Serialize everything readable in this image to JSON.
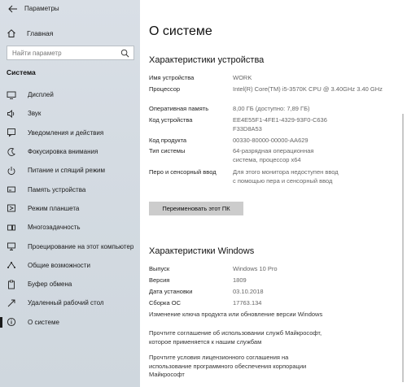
{
  "window": {
    "title": "Параметры"
  },
  "sidebar": {
    "home_label": "Главная",
    "search_placeholder": "Найти параметр",
    "section": "Система",
    "items": [
      {
        "label": "Дисплей",
        "icon": "display-icon"
      },
      {
        "label": "Звук",
        "icon": "sound-icon"
      },
      {
        "label": "Уведомления и действия",
        "icon": "notifications-icon"
      },
      {
        "label": "Фокусировка внимания",
        "icon": "focus-assist-icon"
      },
      {
        "label": "Питание и спящий режим",
        "icon": "power-icon"
      },
      {
        "label": "Память устройства",
        "icon": "storage-icon"
      },
      {
        "label": "Режим планшета",
        "icon": "tablet-mode-icon"
      },
      {
        "label": "Многозадачность",
        "icon": "multitasking-icon"
      },
      {
        "label": "Проецирование на этот компьютер",
        "icon": "projecting-icon"
      },
      {
        "label": "Общие возможности",
        "icon": "shared-experiences-icon"
      },
      {
        "label": "Буфер обмена",
        "icon": "clipboard-icon"
      },
      {
        "label": "Удаленный рабочий стол",
        "icon": "remote-desktop-icon"
      },
      {
        "label": "О системе",
        "icon": "info-icon",
        "selected": true
      }
    ]
  },
  "main": {
    "title": "О системе",
    "device_specs": {
      "heading": "Характеристики устройства",
      "rows": [
        {
          "key": "Имя устройства",
          "value": "WORK"
        },
        {
          "key": "Процессор",
          "value": "Intel(R) Core(TM) i5-3570K CPU @ 3.40GHz   3.40 GHz"
        },
        {
          "key": "Оперативная память",
          "value": "8,00 ГБ (доступно: 7,89 ГБ)"
        },
        {
          "key": "Код устройства",
          "value": "EE4E55F1-4FE1-4329-93F0-C636F33D8A53"
        },
        {
          "key": "Код продукта",
          "value": "00330-80000-00000-AA629"
        },
        {
          "key": "Тип системы",
          "value": "64-разрядная операционная система, процессор x64"
        },
        {
          "key": "Перо и сенсорный ввод",
          "value": "Для этого монитора недоступен ввод с помощью пера и сенсорный ввод"
        }
      ],
      "rename_button": "Переименовать этот ПК"
    },
    "windows_specs": {
      "heading": "Характеристики Windows",
      "rows": [
        {
          "key": "Выпуск",
          "value": "Windows 10 Pro"
        },
        {
          "key": "Версия",
          "value": "1809"
        },
        {
          "key": "Дата установки",
          "value": "03.10.2018"
        },
        {
          "key": "Сборка ОС",
          "value": "17763.134"
        }
      ],
      "change_key_text": "Изменение ключа продукта или обновление версии Windows",
      "services_agreement": "Прочтите соглашение об использовании служб Майкрософт, которое применяется к нашим службам",
      "license_terms": "Прочтите условия лицензионного соглашения на использование программного обеспечения корпорации Майкрософт"
    }
  }
}
